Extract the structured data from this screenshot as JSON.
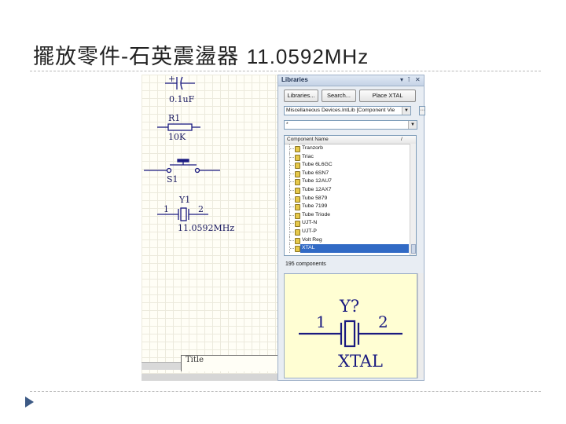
{
  "slide": {
    "title_cjk": "擺放零件-石英震盪器",
    "title_freq": "11.0592MHz"
  },
  "schematic": {
    "cap_value": "0.1uF",
    "cap_plus": "+",
    "res_designator": "R1",
    "res_value": "10K",
    "switch_designator": "S1",
    "crystal_designator": "Y1",
    "crystal_pin1": "1",
    "crystal_pin2": "2",
    "crystal_value": "11.0592MHz",
    "title_block_label": "Title"
  },
  "libraries_panel": {
    "title": "Libraries",
    "header_icons": [
      "dropdown-icon",
      "pin-icon",
      "close-icon"
    ],
    "buttons": {
      "libraries": "Libraries...",
      "search": "Search...",
      "place": "Place XTAL"
    },
    "library_select": "Miscellaneous Devices.IntLib [Component Vie",
    "filter_value": "*",
    "list_header": "Component Name",
    "list_header_sort": "/",
    "components": [
      "Tranzorb",
      "Triac",
      "Tube 6L6GC",
      "Tube 6SN7",
      "Tube 12AU7",
      "Tube 12AX7",
      "Tube 5879",
      "Tube 7199",
      "Tube Triode",
      "UJT-N",
      "UJT-P",
      "Volt Reg",
      "XTAL"
    ],
    "selected_component": "XTAL",
    "component_count": "195 components",
    "preview": {
      "designator": "Y?",
      "pin1": "1",
      "pin2": "2",
      "name": "XTAL"
    }
  },
  "colors": {
    "selection": "#316ac5",
    "preview_bg": "#fffed3",
    "schematic_wire": "#1a1a80",
    "bullet": "#3d5a85"
  }
}
